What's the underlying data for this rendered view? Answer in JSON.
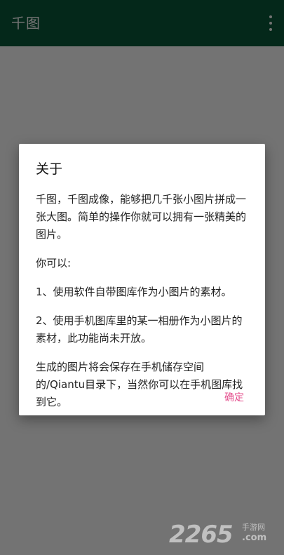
{
  "app": {
    "title": "千图",
    "overflow_icon": "more-vert-icon"
  },
  "dialog": {
    "title": "关于",
    "paragraphs": [
      "千图，千图成像，能够把几千张小图片拼成一张大图。简单的操作你就可以拥有一张精美的图片。",
      "你可以:",
      "1、使用软件自带图库作为小图片的素材。",
      "2、使用手机图库里的某一相册作为小图片的素材，此功能尚未开放。",
      "生成的图片将会保存在手机储存空间的/Qiantu目录下，当然你可以在手机图库找到它。"
    ],
    "confirm_label": "确定"
  },
  "watermark": {
    "number": "2265",
    "chinese": "手游网",
    "domain": ".com"
  },
  "colors": {
    "appbar": "#0a5a3a",
    "accent": "#e44f8d"
  }
}
